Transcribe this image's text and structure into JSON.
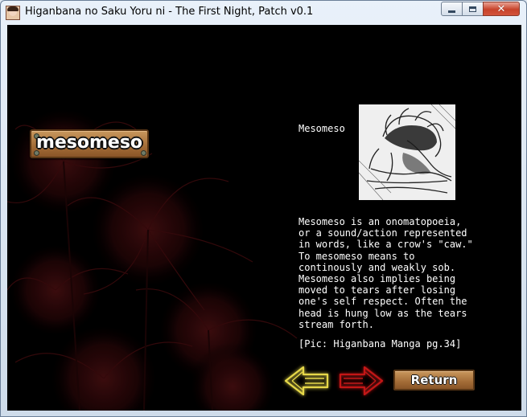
{
  "window": {
    "title": "Higanbana no Saku Yoru ni - The First Night, Patch v0.1",
    "controls": {
      "minimize_icon": "minimize-icon",
      "maximize_icon": "maximize-icon",
      "close_icon": "close-icon"
    }
  },
  "glossary": {
    "term_plaque": "mesomeso",
    "entry_title": "Mesomeso",
    "picture": "manga-panel-image",
    "body_lines": [
      "Mesomeso is an onomatopoeia,",
      "or a sound/action represented",
      "in words, like a crow's \"caw.\"",
      "To mesomeso means to",
      "continously and weakly sob.",
      "Mesomeso also implies being",
      "moved to tears after losing",
      "one's self respect. Often the",
      "head is hung low as the tears",
      "stream forth."
    ],
    "citation": "[Pic: Higanbana Manga pg.34]"
  },
  "navigation": {
    "prev_arrow_icon": "arrow-left-icon",
    "next_arrow_icon": "arrow-right-icon",
    "return_label": "Return"
  },
  "colors": {
    "background": "#000000",
    "prev_arrow": "#e6d84a",
    "next_arrow": "#c41818",
    "plank": "#a36c37",
    "flowers": "#3a0a0c"
  }
}
